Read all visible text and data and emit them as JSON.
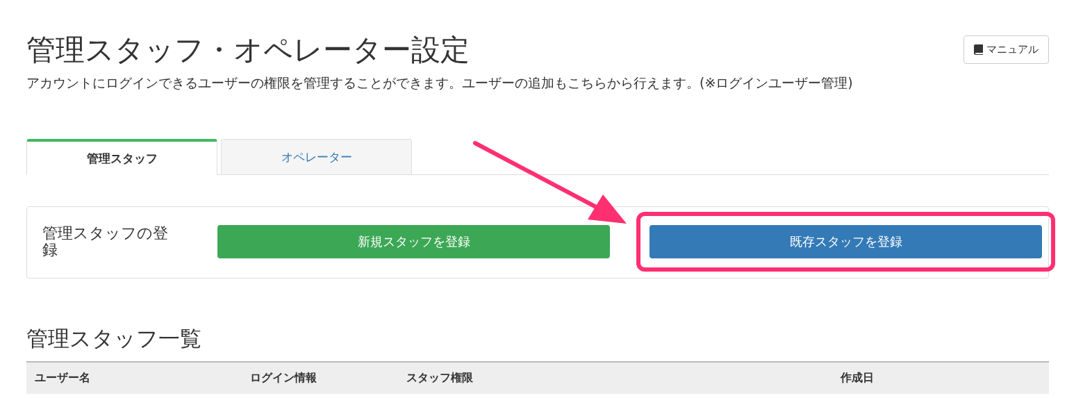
{
  "page": {
    "title": "管理スタッフ・オペレーター設定",
    "description": "アカウントにログインできるユーザーの権限を管理することができます。ユーザーの追加もこちらから行えます。(※ログインユーザー管理)",
    "manual_button": "マニュアル"
  },
  "tabs": [
    {
      "label": "管理スタッフ",
      "selected": true
    },
    {
      "label": "オペレーター",
      "selected": false
    }
  ],
  "register_panel": {
    "label": "管理スタッフの登録",
    "buttons": [
      {
        "label": "新規スタッフを登録",
        "kind": "success",
        "highlighted": false
      },
      {
        "label": "既存スタッフを登録",
        "kind": "primary",
        "highlighted": true
      }
    ]
  },
  "list": {
    "heading": "管理スタッフ一覧",
    "columns": [
      "ユーザー名",
      "ログイン情報",
      "スタッフ権限",
      "作成日"
    ]
  }
}
